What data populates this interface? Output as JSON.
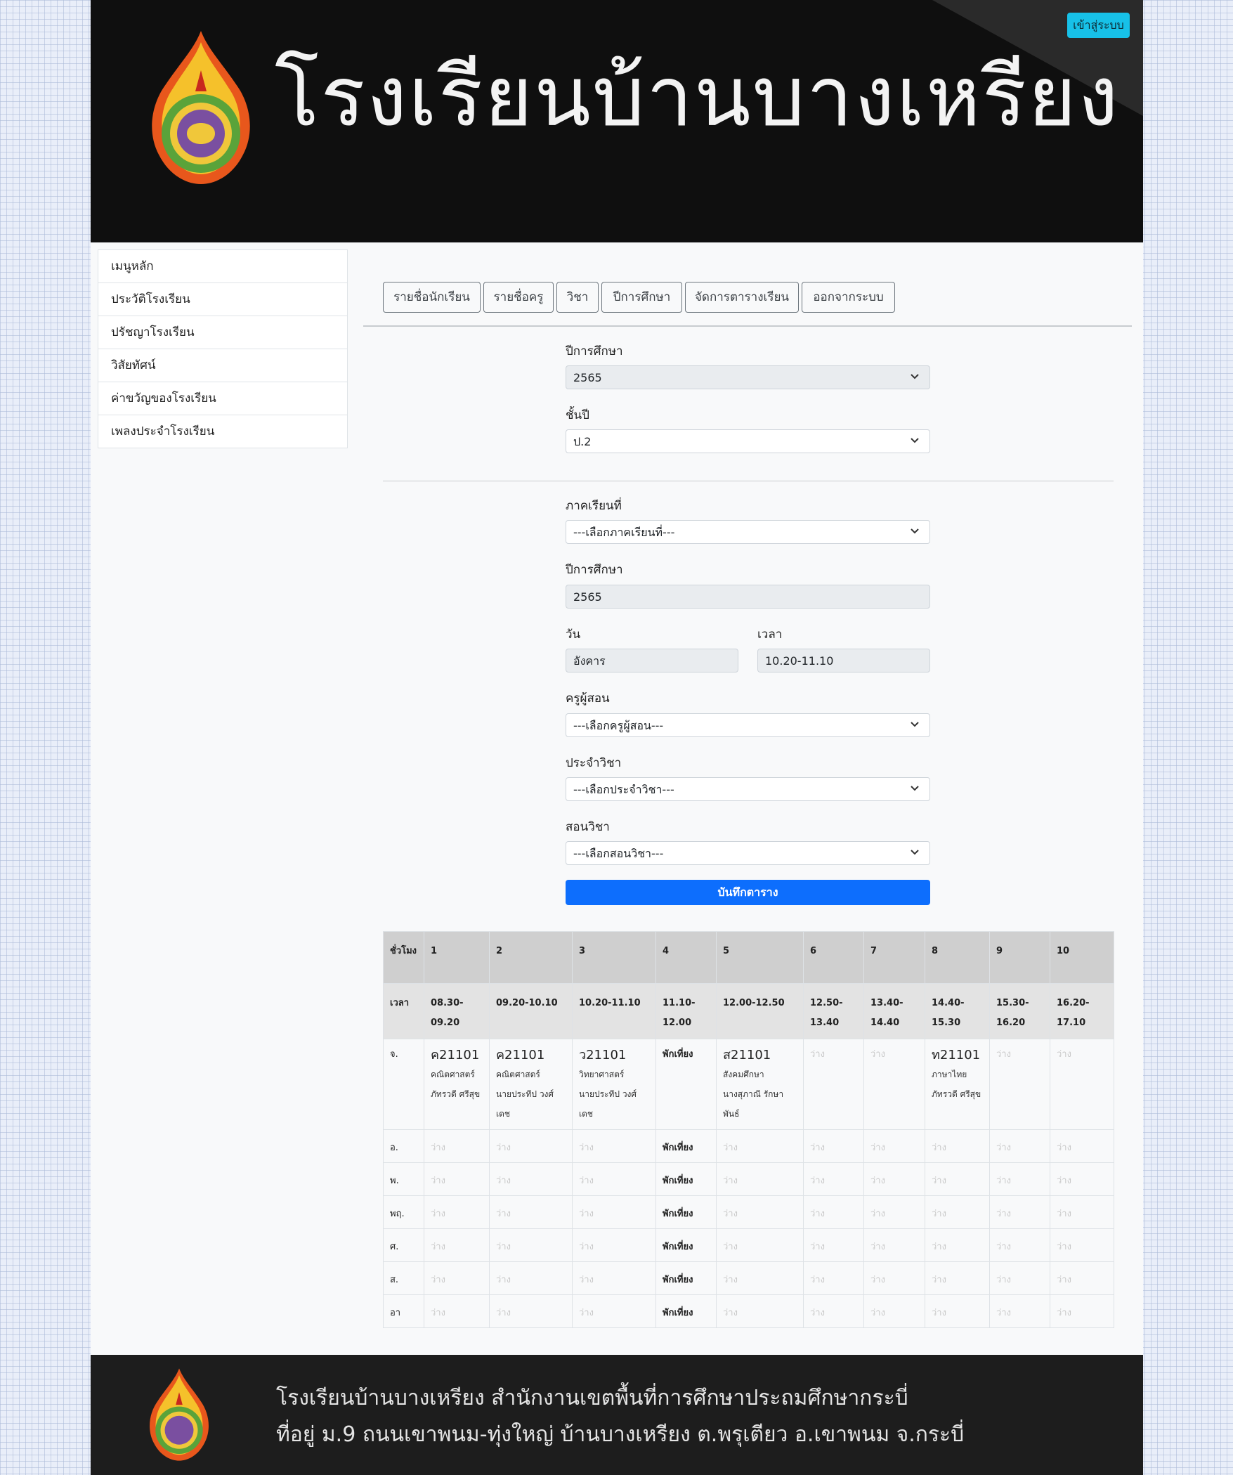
{
  "header": {
    "school_name": "โรงเรียนบ้านบางเหรียง",
    "login_label": "เข้าสู่ระบบ"
  },
  "sidebar": {
    "items": [
      {
        "label": "เมนูหลัก"
      },
      {
        "label": "ประวัติโรงเรียน"
      },
      {
        "label": "ปรัชญาโรงเรียน"
      },
      {
        "label": "วิสัยทัศน์"
      },
      {
        "label": "ค่าขวัญของโรงเรียน"
      },
      {
        "label": "เพลงประจำโรงเรียน"
      }
    ]
  },
  "tabs": [
    {
      "label": "รายชื่อนักเรียน"
    },
    {
      "label": "รายชื่อครู"
    },
    {
      "label": "วิชา"
    },
    {
      "label": "ปีการศึกษา"
    },
    {
      "label": "จัดการตารางเรียน"
    },
    {
      "label": "ออกจากระบบ"
    }
  ],
  "filter": {
    "year_label": "ปีการศึกษา",
    "year_value": "2565",
    "grade_label": "ชั้นปี",
    "grade_value": "ป.2"
  },
  "form": {
    "semester_label": "ภาคเรียนที่",
    "semester_value": "---เลือกภาคเรียนที่---",
    "year_label": "ปีการศึกษา",
    "year_value": "2565",
    "day_label": "วัน",
    "day_value": "อังคาร",
    "time_label": "เวลา",
    "time_value": "10.20-11.10",
    "teacher_label": "ครูผู้สอน",
    "teacher_value": "---เลือกครูผู้สอน---",
    "subject_group_label": "ประจำวิชา",
    "subject_group_value": "---เลือกประจำวิชา---",
    "subject_label": "สอนวิชา",
    "subject_value": "---เลือกสอนวิชา---",
    "save_label": "บันทึกตาราง"
  },
  "timetable": {
    "period_header": "ชั่วโมง",
    "time_header": "เวลา",
    "periods": [
      "1",
      "2",
      "3",
      "4",
      "5",
      "6",
      "7",
      "8",
      "9",
      "10"
    ],
    "times": [
      "08.30-09.20",
      "09.20-10.10",
      "10.20-11.10",
      "11.10-12.00",
      "12.00-12.50",
      "12.50-13.40",
      "13.40-14.40",
      "14.40-15.30",
      "15.30-16.20",
      "16.20-17.10"
    ],
    "monday": {
      "day": "จ.",
      "cells": [
        {
          "code": "ค21101",
          "subject": "คณิตศาสตร์",
          "teacher": "ภัทรวดี ศรีสุข"
        },
        {
          "code": "ค21101",
          "subject": "คณิตศาสตร์",
          "teacher": "นายประทีป วงศ์เดช"
        },
        {
          "code": "ว21101",
          "subject": "วิทยาศาสตร์",
          "teacher": "นายประทีป วงศ์เดช"
        },
        {
          "lunch": "พักเที่ยง"
        },
        {
          "code": "ส21101",
          "subject": "สังคมศึกษา",
          "teacher": "นางสุภาณี รักษาพันธ์"
        },
        {
          "empty": "ว่าง"
        },
        {
          "empty": "ว่าง"
        },
        {
          "code": "ท21101",
          "subject": "ภาษาไทย",
          "teacher": "ภัทรวดี ศรีสุข"
        },
        {
          "empty": "ว่าง"
        },
        {
          "empty": "ว่าง"
        }
      ]
    },
    "other_days": [
      "อ.",
      "พ.",
      "พฤ.",
      "ศ.",
      "ส.",
      "อา"
    ],
    "empty_label": "ว่าง",
    "lunch_label": "พักเที่ยง"
  },
  "footer": {
    "line1": "โรงเรียนบ้านบางเหรียง     สำนักงานเขตพื้นที่การศึกษาประถมศึกษากระบี่",
    "line2": "ที่อยู่ ม.9 ถนนเขาพนม-ทุ่งใหญ่  บ้านบางเหรียง  ต.พรุเตียว  อ.เขาพนม  จ.กระบี่"
  },
  "colors": {
    "header_bg": "#0f0f0f",
    "login_btn": "#17c1e8",
    "save_btn": "#0d6efd",
    "footer_bg": "#1d1d1d"
  }
}
